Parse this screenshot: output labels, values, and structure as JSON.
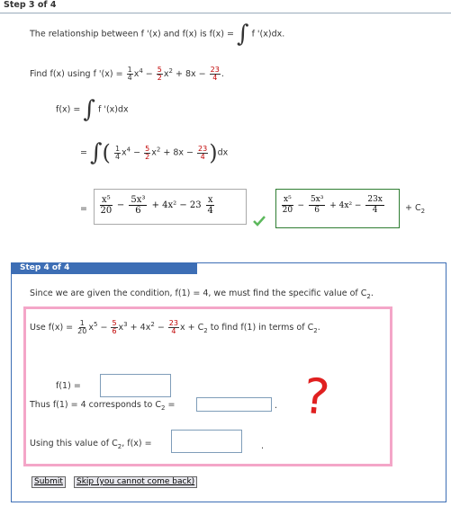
{
  "step3": {
    "header": "Step 3 of 4",
    "intro_text": "The relationship between f '(x) and f(x) is f(x) =",
    "intro_integrand": "f '(x)dx.",
    "find_label": "Find f(x) using f '(x) =",
    "find_t1_num": "1",
    "find_t1_den": "4",
    "find_t1_var": "x",
    "find_t1_exp": "4",
    "find_t2_num": "5",
    "find_t2_den": "2",
    "find_t2_var": "x",
    "find_t2_exp": "2",
    "find_t3": "+ 8x −",
    "find_t4_num": "23",
    "find_t4_den": "4",
    "fx_label": "f(x) =",
    "fx_integrand": "f '(x)dx",
    "eq_sign": "=",
    "line2_t1_num": "1",
    "line2_t1_den": "4",
    "line2_t1_var": "x",
    "line2_t1_exp": "4",
    "line2_t2_num": "5",
    "line2_t2_den": "2",
    "line2_t2_var": "x",
    "line2_t2_exp": "2",
    "line2_t3": "+ 8x −",
    "line2_t4_num": "23",
    "line2_t4_den": "4",
    "line2_dx": "dx",
    "answer_t1_num": "x⁵",
    "answer_t1_den": "20",
    "answer_t2_num": "5x³",
    "answer_t2_den": "6",
    "answer_mid": "+ 4x² − 23",
    "answer_t4_num": "x",
    "answer_t4_den": "4",
    "answer2_t1_num": "x⁵",
    "answer2_t1_den": "20",
    "answer2_t2_num": "5x³",
    "answer2_t2_den": "6",
    "answer2_mid": "+ 4x² −",
    "answer2_t4_num": "23x",
    "answer2_t4_den": "4",
    "plus_c": "+ C",
    "plus_c_sub": "2"
  },
  "step4": {
    "header": "Step 4 of 4",
    "condition_text": "Since we are given the condition, f(1) = 4, we must find the specific value of C",
    "condition_sub": "2",
    "condition_end": ".",
    "use_label": "Use f(x) =",
    "use_t1_num": "1",
    "use_t1_den": "20",
    "use_t1_var": "x",
    "use_t1_exp": "5",
    "use_t2_num": "5",
    "use_t2_den": "6",
    "use_t2_var": "x",
    "use_t2_exp": "3",
    "use_t3": "+ 4x",
    "use_t3_exp": "2",
    "use_t4_num": "23",
    "use_t4_den": "4",
    "use_tail": "x + C",
    "use_tail_sub": "2",
    "use_tail2": "to find f(1) in terms of C",
    "use_tail2_sub": "2",
    "use_tail2_end": ".",
    "f1_label": "f(1) =",
    "thus_text": "Thus f(1) = 4 corresponds to C",
    "thus_sub": "2",
    "thus_eq": "=",
    "thus_end": ".",
    "using_text": "Using this value of C",
    "using_sub": "2",
    "using_text2": ", f(x) =",
    "using_end": ".",
    "question_mark": "?"
  },
  "buttons": {
    "submit": "Submit",
    "skip": "Skip (you cannot come back)"
  },
  "colors": {
    "header_blue": "#3d6eb5",
    "pink_border": "#f4a6c8",
    "green_box": "#2e7d32",
    "check": "#5cb85c",
    "red": "#e02020"
  }
}
